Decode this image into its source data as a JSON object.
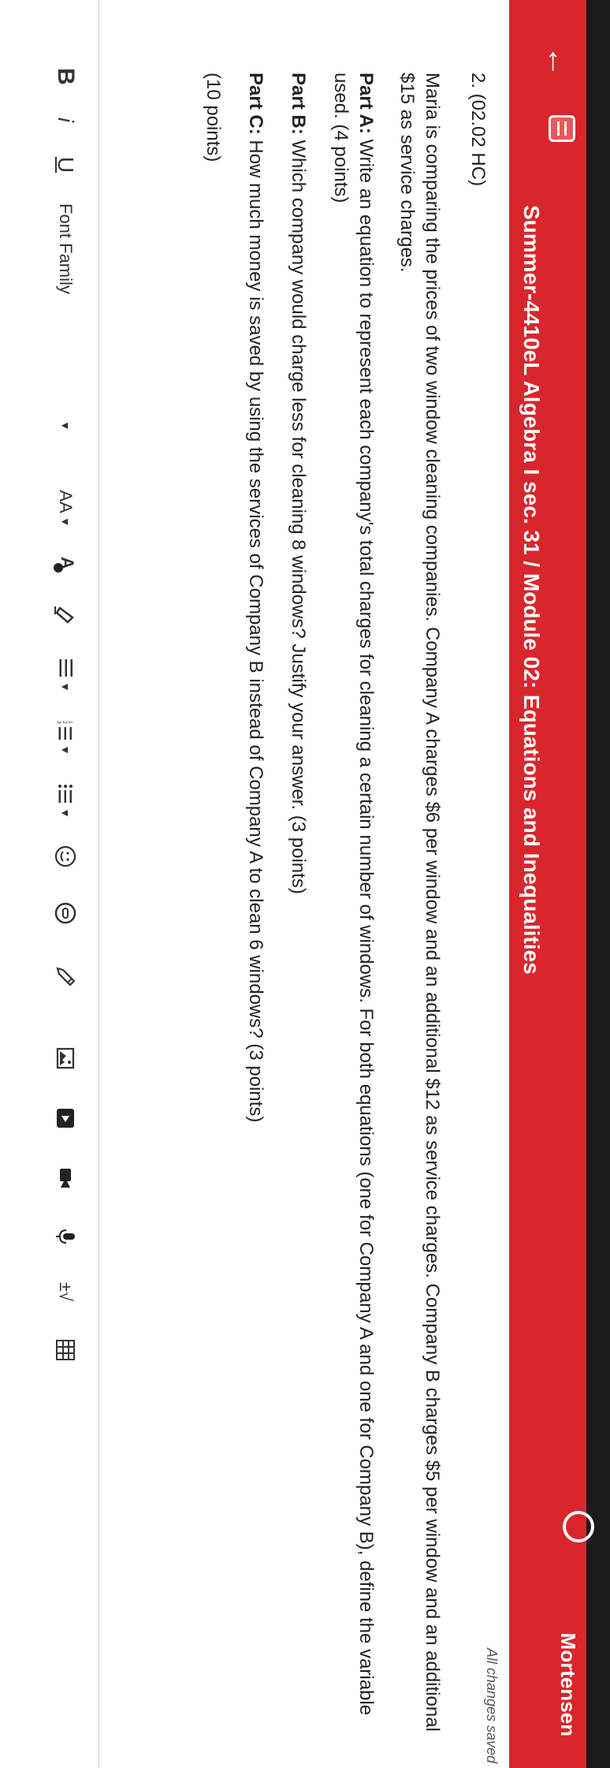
{
  "header": {
    "course_title": "Summer-4410eL Algebra I sec. 31 / Module 02: Equations and Inequalities",
    "user_name": "Mortensen",
    "save_status": "All changes saved"
  },
  "question": {
    "number": "2. (02.02 HC)",
    "stem": "Maria is comparing the prices of two window cleaning companies. Company A charges $6 per window and an additional $12 as service charges. Company B charges $5 per window and an additional $15 as service charges.",
    "parts": [
      {
        "label": "Part A:",
        "text": " Write an equation to represent each company's total charges for cleaning a certain number of windows. For both equations (one for Company A and one for Company B), define the variable used. (4 points)"
      },
      {
        "label": "Part B:",
        "text": " Which company would charge less for cleaning 8 windows? Justify your answer. (3 points)"
      },
      {
        "label": "Part C:",
        "text": " How much money is saved by using the services of Company B instead of Company A to clean 6 windows? (3 points)"
      }
    ],
    "points": "(10 points)"
  },
  "toolbar": {
    "bold": "B",
    "italic": "i",
    "underline": "U",
    "font_family": "Font Family",
    "font_size": "AA",
    "math": "±√"
  },
  "colors": {
    "accent": "#d8262c"
  }
}
